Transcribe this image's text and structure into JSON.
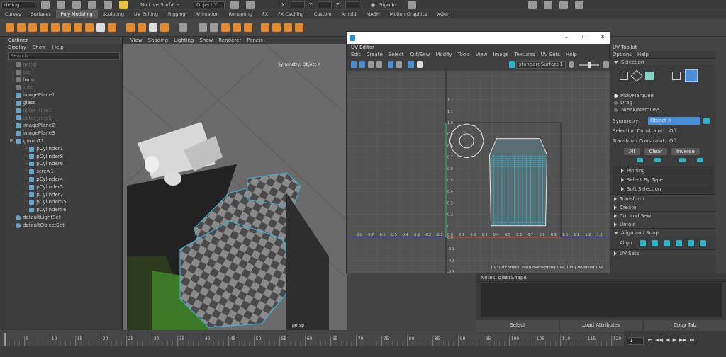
{
  "status_line": {
    "mode": "deling",
    "no_live": "No Live Surface",
    "sym_field": "Object Y",
    "x_label": "X:",
    "y_label": "Y:",
    "z_label": "Z:",
    "sign_in": "Sign In"
  },
  "shelf_tabs": [
    "Curves",
    "Surfaces",
    "Poly Modeling",
    "Sculpting",
    "UV Editing",
    "Rigging",
    "Animation",
    "Rendering",
    "FX",
    "FX Caching",
    "Custom",
    "Arnold",
    "MASH",
    "Motion Graphics",
    "XGen"
  ],
  "shelf_active": "Poly Modeling",
  "outliner": {
    "title": "Outliner",
    "menus": [
      "Display",
      "Show",
      "Help"
    ],
    "search_placeholder": "Search...",
    "items": [
      {
        "name": "persp",
        "type": "cam",
        "dim": true,
        "indent": 0
      },
      {
        "name": "top",
        "type": "cam",
        "dim": true,
        "indent": 0
      },
      {
        "name": "front",
        "type": "cam",
        "dim": false,
        "indent": 0
      },
      {
        "name": "side",
        "type": "cam",
        "dim": true,
        "indent": 0
      },
      {
        "name": "imagePlane1",
        "type": "mesh",
        "dim": false,
        "indent": 0
      },
      {
        "name": "glass",
        "type": "mesh",
        "dim": false,
        "indent": 0
      },
      {
        "name": "outer_side1",
        "type": "mesh",
        "dim": true,
        "indent": 0
      },
      {
        "name": "outer_side2",
        "type": "mesh",
        "dim": true,
        "indent": 0
      },
      {
        "name": "imagePlane2",
        "type": "mesh",
        "dim": false,
        "indent": 0
      },
      {
        "name": "imagePlane3",
        "type": "mesh",
        "dim": false,
        "indent": 0
      },
      {
        "name": "group11",
        "type": "grp",
        "dim": false,
        "indent": 0
      },
      {
        "name": "pCylinder1",
        "type": "mesh",
        "dim": false,
        "indent": 1
      },
      {
        "name": "pCylinder8",
        "type": "mesh",
        "dim": false,
        "indent": 1
      },
      {
        "name": "pCylinder6",
        "type": "mesh",
        "dim": false,
        "indent": 1
      },
      {
        "name": "screw1",
        "type": "mesh",
        "dim": false,
        "indent": 1
      },
      {
        "name": "pCylinder4",
        "type": "mesh",
        "dim": false,
        "indent": 1
      },
      {
        "name": "pCylinder5",
        "type": "mesh",
        "dim": false,
        "indent": 1
      },
      {
        "name": "pCylinder2",
        "type": "mesh",
        "dim": false,
        "indent": 1
      },
      {
        "name": "pCylinder55",
        "type": "mesh",
        "dim": false,
        "indent": 1
      },
      {
        "name": "pCylinder56",
        "type": "mesh",
        "dim": false,
        "indent": 1
      },
      {
        "name": "defaultLightSet",
        "type": "set",
        "dim": false,
        "indent": 0
      },
      {
        "name": "defaultObjectSet",
        "type": "set",
        "dim": false,
        "indent": 0
      }
    ]
  },
  "viewport": {
    "menus": [
      "View",
      "Shading",
      "Lighting",
      "Show",
      "Renderer",
      "Panels"
    ],
    "symmetry": "Symmetry: Object Y",
    "camera": "persp"
  },
  "uv_editor": {
    "title": "UV Editor",
    "menus": [
      "Edit",
      "Create",
      "Select",
      "Cut/Sew",
      "Modify",
      "Tools",
      "View",
      "Image",
      "Textures",
      "UV Sets",
      "Help"
    ],
    "surface": "standardSurface1",
    "status": "(0/3) UV shells, (0/0) overlapping UVs, (0/0) reversed UVs",
    "u_ticks": [
      "-0.8",
      "-0.7",
      "-0.6",
      "-0.5",
      "-0.4",
      "-0.3",
      "-0.2",
      "-0.1",
      "0.0",
      "0.1",
      "0.2",
      "0.3",
      "0.4",
      "0.5",
      "0.6",
      "0.7",
      "0.8",
      "0.9",
      "1.0",
      "1.1",
      "1.2",
      "1.3"
    ],
    "v_ticks": [
      "1.2",
      "1.1",
      "1.0",
      "0.9",
      "0.8",
      "0.7",
      "0.6",
      "0.5",
      "0.4",
      "0.3",
      "0.2",
      "0.1",
      "0.0",
      "-0.1",
      "-0.2",
      "-0.3"
    ]
  },
  "toolkit": {
    "title": "UV Toolkit",
    "menus": [
      "Options",
      "Help"
    ],
    "selection": "Selection",
    "radio": [
      "Pick/Marquee",
      "Drag",
      "Tweak/Marquee"
    ],
    "symmetry_label": "Symmetry:",
    "symmetry_value": "Object X",
    "sel_constraint": "Selection Constraint:",
    "sel_value": "Off",
    "xf_constraint": "Transform Constraint:",
    "xf_value": "Off",
    "btns": [
      "All",
      "Clear",
      "Inverse"
    ],
    "subsections": [
      "Pinning",
      "Select By Type",
      "Soft Selection"
    ],
    "sections": [
      "Transform",
      "Create",
      "Cut and Sew",
      "Unfold",
      "Align and Snap"
    ],
    "align_label": "Align",
    "uvsets": "UV Sets"
  },
  "attr": {
    "notes": "Notes: glassShape",
    "buttons": [
      "Select",
      "Load Attributes",
      "Copy Tab"
    ]
  },
  "timeline": {
    "ticks": [
      "5",
      "10",
      "15",
      "20",
      "25",
      "30",
      "35",
      "40",
      "45",
      "50",
      "55",
      "60",
      "65",
      "70",
      "75",
      "80",
      "85",
      "90",
      "95",
      "100",
      "105",
      "110",
      "115",
      "120"
    ],
    "frame": "1"
  },
  "colors": {
    "accent": "#4a9fd8",
    "uv_blue": "#2fb3c9",
    "shell_white": "#e6e6e6"
  }
}
